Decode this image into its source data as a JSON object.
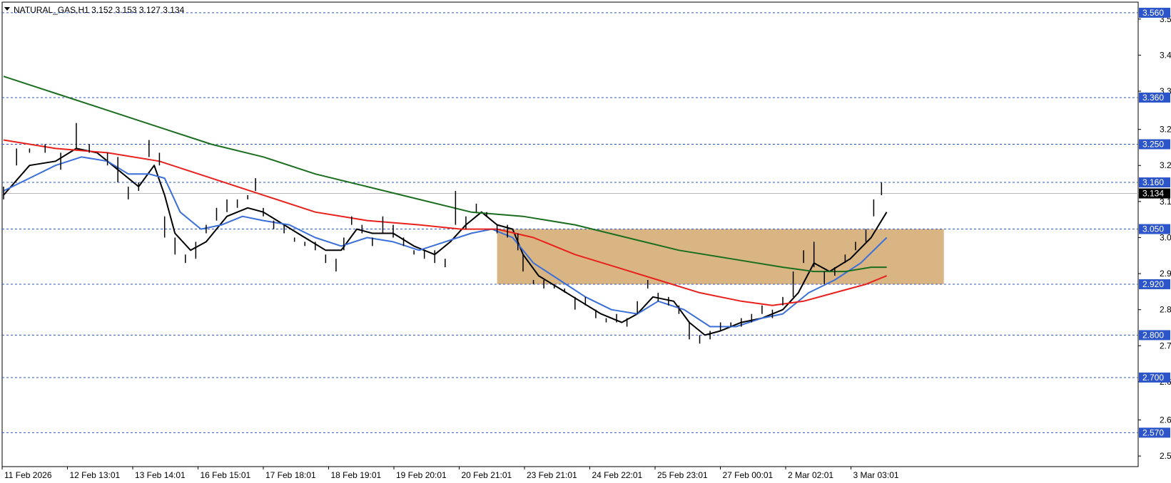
{
  "header": {
    "menu_icon": "triangle-down-icon",
    "title": "NATURAL_GAS,H1  3.152 3.153 3.127 3.134"
  },
  "chart_data": {
    "type": "candlestick",
    "symbol": "NATURAL_GAS",
    "timeframe": "H1",
    "ohlc_last": {
      "open": 3.152,
      "high": 3.153,
      "low": 3.127,
      "close": 3.134
    },
    "current_price": 3.134,
    "ylim": [
      2.49,
      3.585
    ],
    "y_ticks": [
      3.545,
      3.46,
      3.375,
      3.285,
      3.2,
      3.115,
      3.03,
      2.945,
      2.86,
      2.775,
      2.69,
      2.6,
      2.515
    ],
    "x_ticks": [
      "11 Feb 2026",
      "12 Feb 13:01",
      "13 Feb 14:01",
      "16 Feb 15:01",
      "17 Feb 18:01",
      "18 Feb 19:01",
      "19 Feb 20:01",
      "20 Feb 21:01",
      "23 Feb 21:01",
      "24 Feb 22:01",
      "25 Feb 23:01",
      "27 Feb 00:01",
      "2 Mar 02:01",
      "3 Mar 03:01"
    ],
    "horizontal_levels": [
      {
        "value": 3.56,
        "label": "3.560"
      },
      {
        "value": 3.36,
        "label": "3.360"
      },
      {
        "value": 3.25,
        "label": "3.250"
      },
      {
        "value": 3.16,
        "label": "3.160"
      },
      {
        "value": 3.05,
        "label": "3.050"
      },
      {
        "value": 2.92,
        "label": "2.920"
      },
      {
        "value": 2.8,
        "label": "2.800"
      },
      {
        "value": 2.7,
        "label": "2.700"
      },
      {
        "value": 2.57,
        "label": "2.570"
      }
    ],
    "zone": {
      "from_bar": 190,
      "to_bar": 362,
      "low": 2.92,
      "high": 3.05
    },
    "bars": [
      [
        0,
        3.12,
        3.15
      ],
      [
        5,
        3.2,
        3.24
      ],
      [
        10,
        3.23,
        3.24
      ],
      [
        16,
        3.23,
        3.25
      ],
      [
        22,
        3.19,
        3.23
      ],
      [
        28,
        3.24,
        3.3
      ],
      [
        33,
        3.23,
        3.25
      ],
      [
        40,
        3.2,
        3.23
      ],
      [
        44,
        3.16,
        3.22
      ],
      [
        48,
        3.12,
        3.15
      ],
      [
        52,
        3.14,
        3.16
      ],
      [
        56,
        3.22,
        3.26
      ],
      [
        60,
        3.2,
        3.23
      ],
      [
        62,
        3.03,
        3.08
      ],
      [
        66,
        2.99,
        3.03
      ],
      [
        70,
        2.97,
        2.99
      ],
      [
        74,
        2.98,
        3.02
      ],
      [
        78,
        3.04,
        3.06
      ],
      [
        82,
        3.07,
        3.1
      ],
      [
        86,
        3.09,
        3.12
      ],
      [
        90,
        3.1,
        3.12
      ],
      [
        94,
        3.12,
        3.13
      ],
      [
        97,
        3.14,
        3.17
      ],
      [
        100,
        3.08,
        3.1
      ],
      [
        104,
        3.05,
        3.07
      ],
      [
        108,
        3.04,
        3.06
      ],
      [
        112,
        3.02,
        3.03
      ],
      [
        116,
        3.01,
        3.02
      ],
      [
        120,
        3.0,
        3.02
      ],
      [
        124,
        2.97,
        2.99
      ],
      [
        128,
        2.95,
        2.98
      ],
      [
        131,
        3.0,
        3.03
      ],
      [
        134,
        3.06,
        3.08
      ],
      [
        138,
        3.04,
        3.06
      ],
      [
        142,
        3.01,
        3.03
      ],
      [
        146,
        3.04,
        3.08
      ],
      [
        150,
        3.03,
        3.06
      ],
      [
        154,
        3.01,
        3.03
      ],
      [
        158,
        2.99,
        3.0
      ],
      [
        162,
        2.98,
        3.0
      ],
      [
        166,
        2.97,
        3.0
      ],
      [
        170,
        2.96,
        2.98
      ],
      [
        174,
        3.06,
        3.14
      ],
      [
        178,
        3.05,
        3.08
      ],
      [
        182,
        3.09,
        3.11
      ],
      [
        186,
        3.08,
        3.09
      ],
      [
        190,
        3.04,
        3.06
      ],
      [
        194,
        3.03,
        3.06
      ],
      [
        198,
        3.0,
        3.04
      ],
      [
        200,
        2.95,
        2.99
      ],
      [
        204,
        2.92,
        2.93
      ],
      [
        208,
        2.91,
        2.93
      ],
      [
        212,
        2.91,
        2.92
      ],
      [
        216,
        2.9,
        2.91
      ],
      [
        220,
        2.86,
        2.89
      ],
      [
        224,
        2.87,
        2.89
      ],
      [
        228,
        2.84,
        2.86
      ],
      [
        232,
        2.83,
        2.84
      ],
      [
        236,
        2.83,
        2.85
      ],
      [
        240,
        2.82,
        2.84
      ],
      [
        244,
        2.85,
        2.88
      ],
      [
        248,
        2.91,
        2.93
      ],
      [
        252,
        2.88,
        2.9
      ],
      [
        256,
        2.87,
        2.89
      ],
      [
        260,
        2.85,
        2.87
      ],
      [
        264,
        2.79,
        2.83
      ],
      [
        268,
        2.78,
        2.8
      ],
      [
        272,
        2.79,
        2.81
      ],
      [
        276,
        2.81,
        2.83
      ],
      [
        280,
        2.82,
        2.83
      ],
      [
        284,
        2.82,
        2.84
      ],
      [
        288,
        2.83,
        2.85
      ],
      [
        292,
        2.85,
        2.87
      ],
      [
        296,
        2.84,
        2.86
      ],
      [
        300,
        2.87,
        2.89
      ],
      [
        304,
        2.89,
        2.95
      ],
      [
        308,
        2.97,
        3.0
      ],
      [
        312,
        2.96,
        3.02
      ],
      [
        316,
        2.92,
        2.95
      ],
      [
        320,
        2.94,
        2.96
      ],
      [
        324,
        2.97,
        2.99
      ],
      [
        328,
        3.0,
        3.02
      ],
      [
        332,
        3.02,
        3.05
      ],
      [
        335,
        3.08,
        3.12
      ],
      [
        338,
        3.13,
        3.16
      ]
    ],
    "series": [
      {
        "color": "#000000",
        "values": [
          [
            0,
            3.13
          ],
          [
            10,
            3.2
          ],
          [
            20,
            3.21
          ],
          [
            28,
            3.24
          ],
          [
            36,
            3.23
          ],
          [
            44,
            3.19
          ],
          [
            52,
            3.15
          ],
          [
            58,
            3.2
          ],
          [
            62,
            3.13
          ],
          [
            66,
            3.04
          ],
          [
            72,
            3.0
          ],
          [
            78,
            3.02
          ],
          [
            86,
            3.08
          ],
          [
            94,
            3.1
          ],
          [
            100,
            3.09
          ],
          [
            108,
            3.06
          ],
          [
            116,
            3.03
          ],
          [
            124,
            3.0
          ],
          [
            130,
            3.0
          ],
          [
            136,
            3.05
          ],
          [
            142,
            3.04
          ],
          [
            150,
            3.04
          ],
          [
            158,
            3.01
          ],
          [
            166,
            2.99
          ],
          [
            172,
            3.02
          ],
          [
            178,
            3.06
          ],
          [
            184,
            3.09
          ],
          [
            190,
            3.06
          ],
          [
            196,
            3.05
          ],
          [
            200,
            2.99
          ],
          [
            206,
            2.94
          ],
          [
            214,
            2.91
          ],
          [
            222,
            2.88
          ],
          [
            230,
            2.85
          ],
          [
            238,
            2.83
          ],
          [
            244,
            2.85
          ],
          [
            250,
            2.89
          ],
          [
            258,
            2.88
          ],
          [
            264,
            2.83
          ],
          [
            270,
            2.8
          ],
          [
            276,
            2.81
          ],
          [
            284,
            2.83
          ],
          [
            292,
            2.84
          ],
          [
            300,
            2.86
          ],
          [
            306,
            2.9
          ],
          [
            312,
            2.97
          ],
          [
            318,
            2.95
          ],
          [
            326,
            2.98
          ],
          [
            334,
            3.03
          ],
          [
            340,
            3.09
          ]
        ]
      },
      {
        "color": "#3b6fd8",
        "values": [
          [
            0,
            3.14
          ],
          [
            10,
            3.17
          ],
          [
            20,
            3.2
          ],
          [
            30,
            3.22
          ],
          [
            40,
            3.21
          ],
          [
            48,
            3.18
          ],
          [
            56,
            3.18
          ],
          [
            62,
            3.17
          ],
          [
            68,
            3.09
          ],
          [
            76,
            3.05
          ],
          [
            84,
            3.06
          ],
          [
            92,
            3.08
          ],
          [
            100,
            3.07
          ],
          [
            110,
            3.06
          ],
          [
            120,
            3.03
          ],
          [
            130,
            3.01
          ],
          [
            140,
            3.03
          ],
          [
            150,
            3.02
          ],
          [
            160,
            3.0
          ],
          [
            170,
            3.02
          ],
          [
            180,
            3.04
          ],
          [
            188,
            3.05
          ],
          [
            196,
            3.03
          ],
          [
            204,
            2.97
          ],
          [
            214,
            2.93
          ],
          [
            224,
            2.89
          ],
          [
            234,
            2.86
          ],
          [
            244,
            2.85
          ],
          [
            252,
            2.88
          ],
          [
            262,
            2.86
          ],
          [
            272,
            2.82
          ],
          [
            282,
            2.82
          ],
          [
            292,
            2.84
          ],
          [
            300,
            2.85
          ],
          [
            310,
            2.9
          ],
          [
            320,
            2.93
          ],
          [
            330,
            2.97
          ],
          [
            340,
            3.03
          ]
        ]
      },
      {
        "color": "#e8211c",
        "values": [
          [
            0,
            3.26
          ],
          [
            20,
            3.24
          ],
          [
            40,
            3.23
          ],
          [
            60,
            3.21
          ],
          [
            80,
            3.17
          ],
          [
            100,
            3.13
          ],
          [
            120,
            3.09
          ],
          [
            140,
            3.07
          ],
          [
            160,
            3.06
          ],
          [
            176,
            3.05
          ],
          [
            190,
            3.05
          ],
          [
            204,
            3.03
          ],
          [
            220,
            2.99
          ],
          [
            236,
            2.96
          ],
          [
            252,
            2.93
          ],
          [
            268,
            2.9
          ],
          [
            284,
            2.88
          ],
          [
            296,
            2.87
          ],
          [
            308,
            2.88
          ],
          [
            320,
            2.9
          ],
          [
            332,
            2.92
          ],
          [
            340,
            2.94
          ]
        ]
      },
      {
        "color": "#1b6e1f",
        "values": [
          [
            0,
            3.41
          ],
          [
            20,
            3.37
          ],
          [
            40,
            3.33
          ],
          [
            60,
            3.29
          ],
          [
            80,
            3.25
          ],
          [
            100,
            3.22
          ],
          [
            120,
            3.18
          ],
          [
            140,
            3.15
          ],
          [
            160,
            3.12
          ],
          [
            180,
            3.09
          ],
          [
            200,
            3.08
          ],
          [
            220,
            3.06
          ],
          [
            240,
            3.03
          ],
          [
            260,
            3.0
          ],
          [
            280,
            2.98
          ],
          [
            300,
            2.96
          ],
          [
            312,
            2.95
          ],
          [
            324,
            2.95
          ],
          [
            334,
            2.96
          ],
          [
            340,
            2.96
          ]
        ]
      }
    ]
  }
}
